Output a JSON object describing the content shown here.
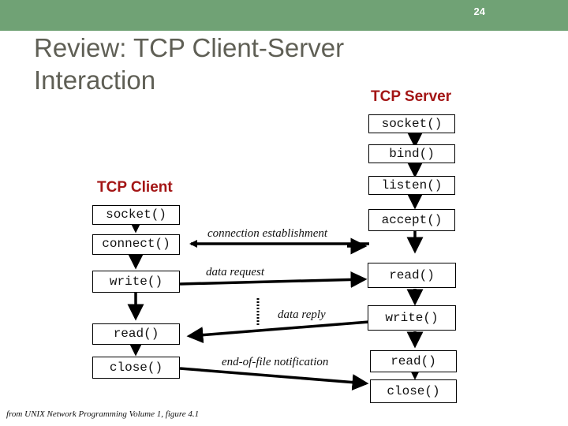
{
  "slide": {
    "number": "24",
    "title_line1": "Review: TCP Client-Server",
    "title_line2": "Interaction",
    "header_color": "#70a275",
    "heading_color": "#a31515"
  },
  "server": {
    "heading": "TCP Server",
    "steps": [
      "socket()",
      "bind()",
      "listen()",
      "accept()",
      "read()",
      "write()",
      "read()",
      "close()"
    ]
  },
  "client": {
    "heading": "TCP Client",
    "steps": [
      "socket()",
      "connect()",
      "write()",
      "read()",
      "close()"
    ]
  },
  "messages": {
    "connection": "connection establishment",
    "request": "data request",
    "reply": "data reply",
    "eof": "end-of-file notification"
  },
  "caption": "from UNIX Network Programming Volume 1, figure 4.1"
}
